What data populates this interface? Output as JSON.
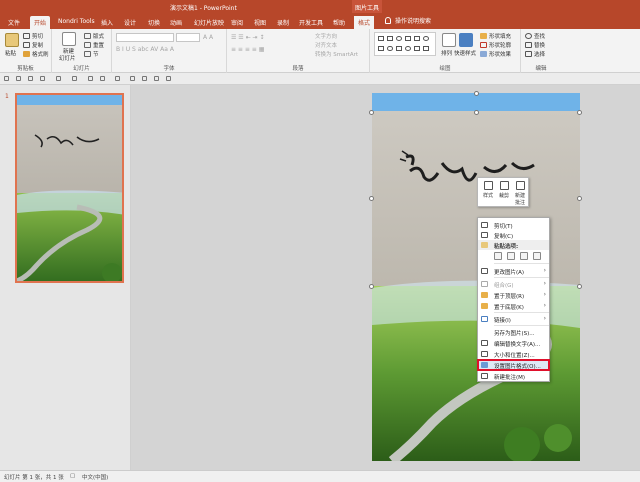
{
  "window": {
    "title": "演示文稿1 - PowerPoint",
    "contextual_tab_group": "图片工具"
  },
  "tabs": [
    {
      "label": "文件"
    },
    {
      "label": "开始"
    },
    {
      "label": "Nondri Tools"
    },
    {
      "label": "插入"
    },
    {
      "label": "设计"
    },
    {
      "label": "切换"
    },
    {
      "label": "动画"
    },
    {
      "label": "幻灯片放映"
    },
    {
      "label": "审阅"
    },
    {
      "label": "视图"
    },
    {
      "label": "录制"
    },
    {
      "label": "开发工具"
    },
    {
      "label": "帮助"
    },
    {
      "label": "格式"
    }
  ],
  "active_tab": "开始",
  "tell_me": "操作说明搜索",
  "ribbon": {
    "clipboard": {
      "label": "剪贴板",
      "paste": "粘贴",
      "cut": "剪切",
      "copy": "复制",
      "format_painter": "格式刷"
    },
    "slides": {
      "label": "幻灯片",
      "new_slide_line1": "新建",
      "new_slide_line2": "幻灯片",
      "layout": "版式",
      "reset": "重置",
      "section": "节"
    },
    "font": {
      "label": "字体"
    },
    "paragraph": {
      "label": "段落",
      "text_direction": "文字方向",
      "align_text": "对齐文本",
      "smartart": "转换为 SmartArt"
    },
    "drawing": {
      "label": "绘图",
      "arrange": "排列",
      "quick_styles": "快速样式",
      "shape_fill": "形状填充",
      "shape_outline": "形状轮廓",
      "shape_effects": "形状效果"
    },
    "editing": {
      "label": "编辑",
      "find": "查找",
      "replace": "替换",
      "select": "选择"
    }
  },
  "thumbnail_pane": {
    "slide_number": "1"
  },
  "mini_toolbar": {
    "style": "样式",
    "crop": "裁剪",
    "new_comment_line1": "新建",
    "new_comment_line2": "批注"
  },
  "context_menu": {
    "cut": "剪切(T)",
    "copy": "复制(C)",
    "paste_options": "粘贴选项:",
    "change_picture": "更改图片(A)",
    "group": "组合(G)",
    "bring_to_front": "置于顶层(R)",
    "send_to_back": "置于底层(K)",
    "link": "链接(I)",
    "save_as_picture": "另存为图片(S)...",
    "edit_alt_text": "编辑替换文字(A)...",
    "size_position": "大小和位置(Z)...",
    "format_picture": "设置图片格式(O)...",
    "new_comment": "新建批注(M)"
  },
  "status_bar": {
    "slide_info": "幻灯片 第 1 张，共 1 张",
    "language": "中文(中国)"
  },
  "colors": {
    "accent": "#b7472a",
    "selection_highlight": "#e0102c"
  }
}
